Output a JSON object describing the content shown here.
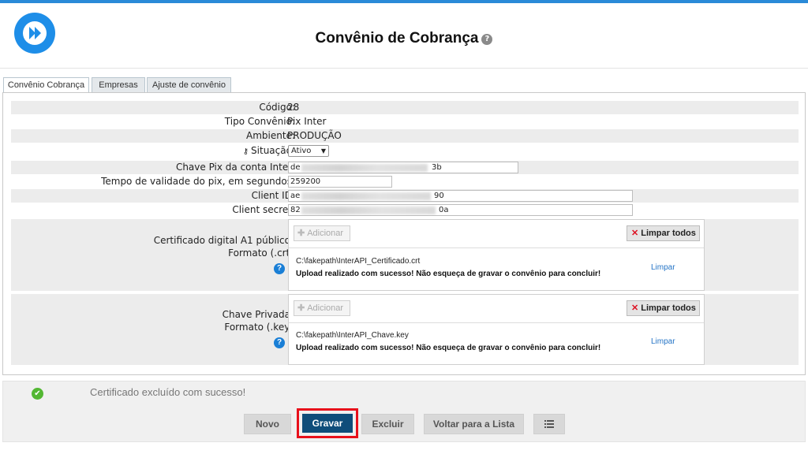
{
  "header": {
    "title": "Convênio de Cobrança",
    "help_glyph": "?"
  },
  "tabs": [
    {
      "label": "Convênio Cobrança",
      "active": true
    },
    {
      "label": "Empresas",
      "active": false
    },
    {
      "label": "Ajuste de convênio",
      "active": false
    }
  ],
  "form": {
    "codigo": {
      "label": "Código:",
      "value": "28"
    },
    "tipo": {
      "label": "Tipo Convênio:",
      "value": "Pix Inter"
    },
    "ambiente": {
      "label": "Ambiente:",
      "value": "PRODUÇÃO"
    },
    "situacao": {
      "label": "Situação:",
      "value": "Ativo"
    },
    "chave_pix": {
      "label": "Chave Pix da conta Inter:",
      "prefix": "de",
      "suffix": "3b"
    },
    "tempo": {
      "label": "Tempo de validade do pix, em segundos:",
      "value": "259200"
    },
    "client_id": {
      "label": "Client ID:",
      "prefix": "ae",
      "suffix": "90"
    },
    "client_secret": {
      "label": "Client secret:",
      "prefix": "82",
      "suffix": "0a"
    }
  },
  "cert": {
    "label_line1": "Certificado digital A1 público:",
    "label_line2": "Formato (.crt)",
    "add_label": "Adicionar",
    "clear_all_label": "Limpar todos",
    "file_path": "C:\\fakepath\\InterAPI_Certificado.crt",
    "message": "Upload realizado com sucesso! Não esqueça de gravar o convênio para concluir!",
    "clear_label": "Limpar"
  },
  "key": {
    "label_line1": "Chave Privada:",
    "label_line2": "Formato (.key)",
    "add_label": "Adicionar",
    "clear_all_label": "Limpar todos",
    "file_path": "C:\\fakepath\\InterAPI_Chave.key",
    "message": "Upload realizado com sucesso! Não esqueça de gravar o convênio para concluir!",
    "clear_label": "Limpar"
  },
  "status": {
    "message": "Certificado excluído com sucesso!",
    "icon": "check-icon",
    "color": "#53b733"
  },
  "actions": {
    "novo": "Novo",
    "gravar": "Gravar",
    "excluir": "Excluir",
    "voltar": "Voltar para a Lista"
  },
  "colors": {
    "accent": "#1e8ee8",
    "primary_button": "#0f4d7a",
    "highlight": "#e8101b",
    "link": "#2474c6"
  }
}
